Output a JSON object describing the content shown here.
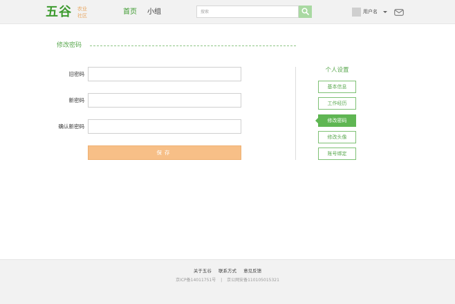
{
  "header": {
    "logo": {
      "main": "五谷",
      "sub_line1": "农业",
      "sub_line2": "社区"
    },
    "nav": {
      "home": "首页",
      "group": "小组"
    },
    "search": {
      "placeholder": "搜索"
    },
    "user": {
      "name": "用户名"
    }
  },
  "main": {
    "section_title": "修改密码",
    "form": {
      "old_password_label": "旧密码",
      "new_password_label": "新密码",
      "confirm_password_label": "确认新密码",
      "old_password_value": "",
      "new_password_value": "",
      "confirm_password_value": "",
      "save_label": "保存"
    },
    "sidebar": {
      "title": "个人设置",
      "items": [
        {
          "label": "基本信息",
          "active": false
        },
        {
          "label": "工作经历",
          "active": false
        },
        {
          "label": "修改密码",
          "active": true
        },
        {
          "label": "修改头像",
          "active": false
        },
        {
          "label": "账号绑定",
          "active": false
        }
      ]
    }
  },
  "footer": {
    "links": [
      "关于五谷",
      "联系方式",
      "意见反馈"
    ],
    "icp": "京ICP备14011751号",
    "separator": "|",
    "police": "京公网安备110105015321"
  },
  "colors": {
    "brand_green": "#3c9a2e",
    "accent_green": "#5fb653",
    "save_orange": "#f7bf87",
    "logo_orange": "#e8a35a"
  }
}
